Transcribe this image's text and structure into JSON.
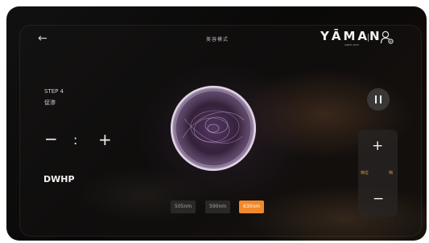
{
  "header": {
    "back_glyph": "←",
    "title": "美容模式",
    "brand": {
      "logo": "YĀMAN",
      "since": "SINCE 1978"
    }
  },
  "step": {
    "number": "STEP 4",
    "name": "促渗"
  },
  "timer": {
    "minus": "−",
    "separator": ":",
    "plus": "+"
  },
  "mode": {
    "label": "DWHP"
  },
  "wavelengths": [
    {
      "label": "505nm",
      "active": false
    },
    {
      "label": "590nm",
      "active": false
    },
    {
      "label": "630nm",
      "active": true
    }
  ],
  "intensity": {
    "plus": "+",
    "minus": "−",
    "level_left": "档位",
    "level_right": "档"
  },
  "colors": {
    "accent": "#f0892b",
    "orb_glow": "#b07fd0",
    "background": "#0b0a09"
  },
  "icons": [
    "back-arrow-icon",
    "user-settings-icon",
    "pause-icon"
  ]
}
